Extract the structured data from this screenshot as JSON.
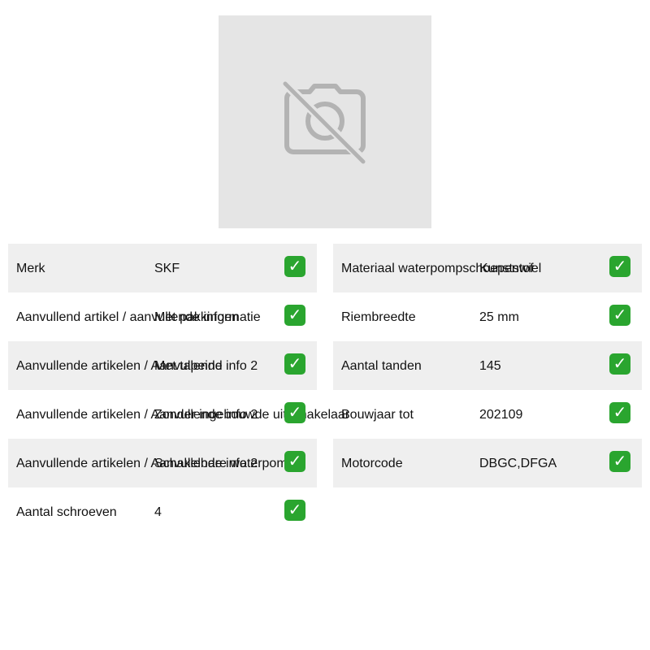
{
  "image": {
    "icon": "no-photo-icon"
  },
  "check_icon": "check-icon",
  "accent_color": "#2aa52f",
  "left_table": [
    {
      "label": "Merk",
      "value": "SKF"
    },
    {
      "label": "Aanvullend artikel / aanvullende informatie",
      "value": "Met pakkingen"
    },
    {
      "label": "Aanvullende artikelen / Aanvullende info 2",
      "value": "Met tapeind"
    },
    {
      "label": "Aanvullende artikelen / Aanvullende info 2",
      "value": "Zonder ingebouwde uitschakelaar"
    },
    {
      "label": "Aanvullende artikelen / Aanvullende info 2",
      "value": "Schakelbare waterpomp"
    },
    {
      "label": "Aantal schroeven",
      "value": "4"
    }
  ],
  "right_table": [
    {
      "label": "Materiaal waterpompschoepenwiel",
      "value": "Kunststof"
    },
    {
      "label": "Riembreedte",
      "value": "25 mm"
    },
    {
      "label": "Aantal tanden",
      "value": "145"
    },
    {
      "label": "Bouwjaar tot",
      "value": "202109"
    },
    {
      "label": "Motorcode",
      "value": "DBGC,DFGA"
    }
  ]
}
